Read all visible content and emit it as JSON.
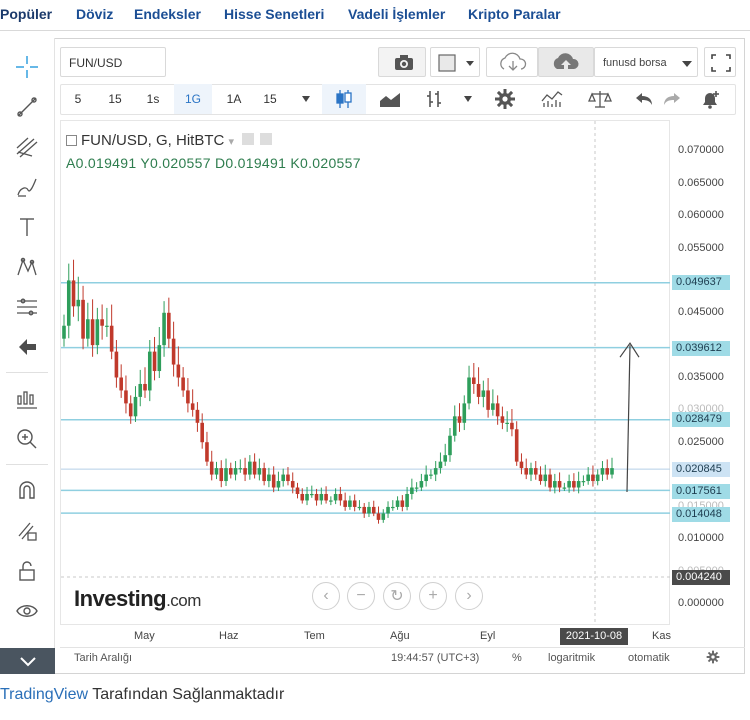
{
  "nav": {
    "items": [
      "Popüler",
      "Döviz",
      "Endeksler",
      "Hisse Senetleri",
      "Vadeli İşlemler",
      "Kripto Paralar"
    ]
  },
  "toolbar": {
    "symbol": "FUN/USD",
    "intervals": [
      "5",
      "15",
      "1s",
      "1G",
      "1A",
      "15"
    ],
    "active_interval": "1G",
    "layout_name": "funusd borsa"
  },
  "legend": {
    "title": "FUN/USD, G, HitBTC",
    "ohlc": "A0.019491  Y0.020557  D0.019491  K0.020557"
  },
  "price_axis": {
    "ticks": [
      "0.070000",
      "0.065000",
      "0.060000",
      "0.055000",
      "0.045000",
      "0.035000",
      "0.030000",
      "0.025000",
      "0.015000",
      "0.010000",
      "0.005000",
      "0.000000"
    ],
    "tags": {
      "level_1": "0.049637",
      "level_2": "0.039612",
      "level_3": "0.028479",
      "current": "0.020845",
      "level_4": "0.017561",
      "level_5": "0.014048",
      "cursor": "0.004240"
    }
  },
  "time_axis": {
    "labels": [
      "May",
      "Haz",
      "Tem",
      "Ağu",
      "Eyl",
      "Kas"
    ],
    "cursor_date": "2021-10-08"
  },
  "bottom_bar": {
    "range": "Tarih Aralığı",
    "time": "19:44:57 (UTC+3)",
    "percent": "%",
    "log": "logaritmik",
    "auto": "otomatik"
  },
  "watermark": {
    "brand": "Investing",
    "suffix": ".com"
  },
  "footer": {
    "link": "TradingView",
    "text": " Tarafından Sağlanmaktadır"
  },
  "colors": {
    "up": "#2e9e5b",
    "down": "#c0392b",
    "hline": "#8fcfe0",
    "nav": "#1b4e94"
  }
}
